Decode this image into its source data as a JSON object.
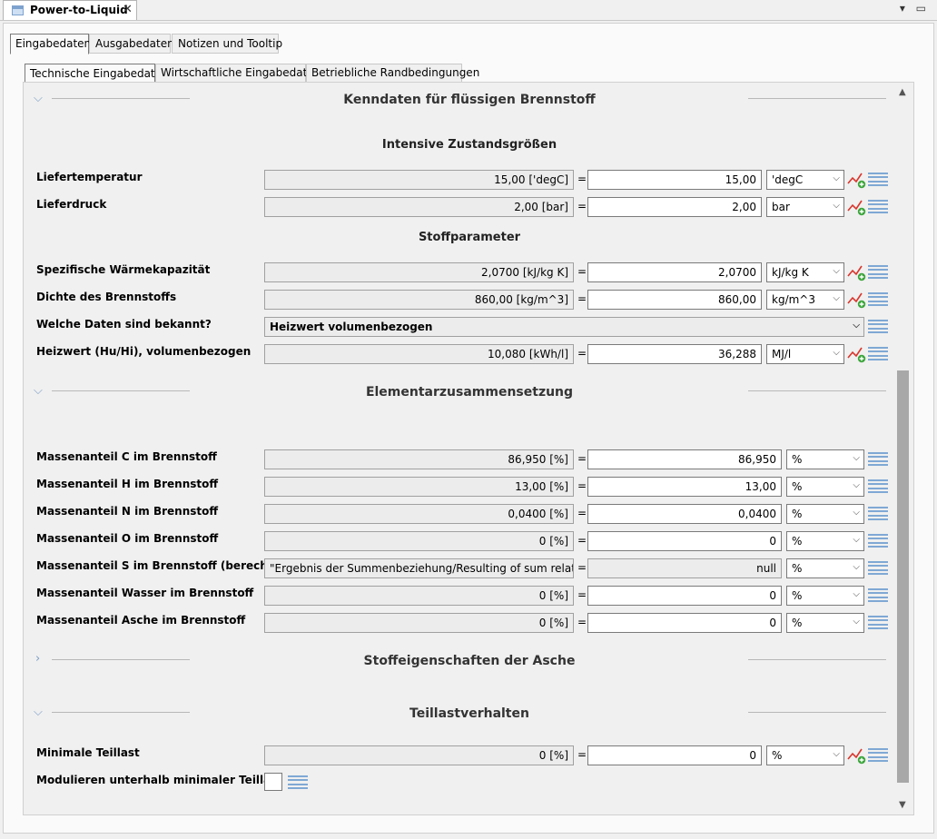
{
  "window": {
    "title": "Power-to-Liquid"
  },
  "tabs_level1": [
    "Eingabedaten",
    "Ausgabedaten",
    "Notizen und Tooltip"
  ],
  "tabs_level2": [
    "Technische Eingabedaten",
    "Wirtschaftliche Eingabedaten",
    "Betriebliche Randbedingungen"
  ],
  "sections": {
    "s1": "Kenndaten für flüssigen Brennstoff",
    "s1_sub1": "Intensive Zustandsgrößen",
    "s1_sub2": "Stoffparameter",
    "s2": "Elementarzusammensetzung",
    "s3": "Stoffeigenschaften der Asche",
    "s4": "Teillastverhalten"
  },
  "rows": {
    "liefertemperatur": {
      "label": "Liefertemperatur",
      "display": "15,00 ['degC]",
      "value": "15,00",
      "unit": "'degC"
    },
    "lieferdruck": {
      "label": "Lieferdruck",
      "display": "2,00 [bar]",
      "value": "2,00",
      "unit": "bar"
    },
    "waermekapazitaet": {
      "label": "Spezifische Wärmekapazität",
      "display": "2,0700 [kJ/kg K]",
      "value": "2,0700",
      "unit": "kJ/kg K"
    },
    "dichte": {
      "label": "Dichte des Brennstoffs",
      "display": "860,00 [kg/m^3]",
      "value": "860,00",
      "unit": "kg/m^3"
    },
    "daten": {
      "label": "Welche Daten sind bekannt?",
      "value": "Heizwert volumenbezogen"
    },
    "heizwert": {
      "label": "Heizwert (Hu/Hi), volumenbezogen",
      "display": "10,080 [kWh/l]",
      "value": "36,288",
      "unit": "MJ/l"
    },
    "anteil_c": {
      "label": "Massenanteil C im Brennstoff",
      "display": "86,950 [%]",
      "value": "86,950",
      "unit": "%"
    },
    "anteil_h": {
      "label": "Massenanteil H im Brennstoff",
      "display": "13,00 [%]",
      "value": "13,00",
      "unit": "%"
    },
    "anteil_n": {
      "label": "Massenanteil N im Brennstoff",
      "display": "0,0400 [%]",
      "value": "0,0400",
      "unit": "%"
    },
    "anteil_o": {
      "label": "Massenanteil O im Brennstoff",
      "display": "0 [%]",
      "value": "0",
      "unit": "%"
    },
    "anteil_s": {
      "label": "Massenanteil S im Brennstoff (berechnet)",
      "display": "\"Ergebnis der Summenbeziehung/Resulting of sum relation\" n",
      "value": "null",
      "unit": "%"
    },
    "anteil_wasser": {
      "label": "Massenanteil Wasser im Brennstoff",
      "display": "0 [%]",
      "value": "0",
      "unit": "%"
    },
    "anteil_asche": {
      "label": "Massenanteil Asche im Brennstoff",
      "display": "0 [%]",
      "value": "0",
      "unit": "%"
    },
    "min_teillast": {
      "label": "Minimale Teillast",
      "display": "0 [%]",
      "value": "0",
      "unit": "%"
    },
    "modulieren": {
      "label": "Modulieren unterhalb minimaler Teillast"
    }
  },
  "icons": {
    "trend": "trend-add-icon",
    "menu": "list-menu-icon",
    "expand": "chevron-icon"
  },
  "colors": {
    "accent": "#7fa8d4",
    "trend_red": "#d9352b",
    "trend_green": "#3aa53a"
  }
}
